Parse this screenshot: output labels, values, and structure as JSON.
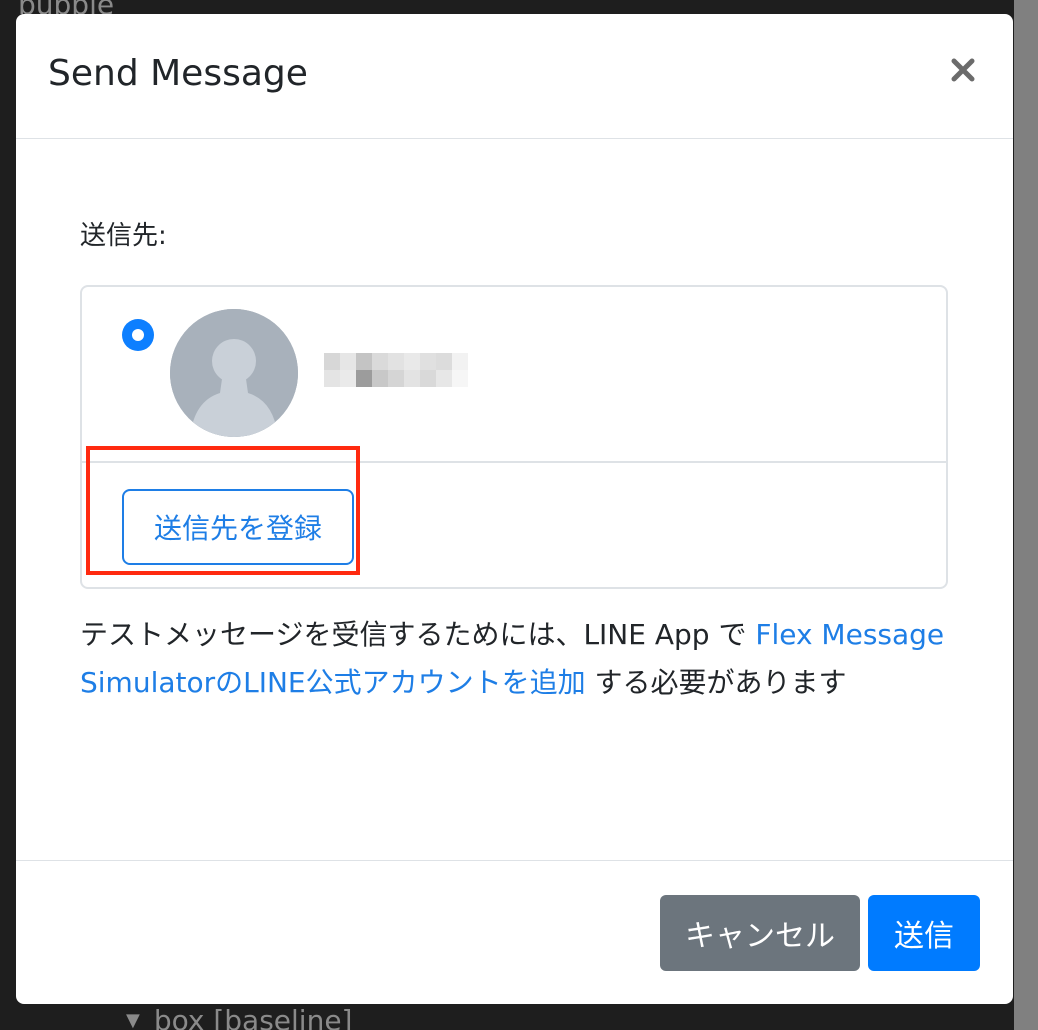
{
  "background": {
    "top_hint": "bubble",
    "bottom_hint": "box [baseline]"
  },
  "modal": {
    "title": "Send Message",
    "close_icon": "close-icon",
    "recipient_label": "送信先:",
    "recipient": {
      "selected": true,
      "avatar_icon": "person-silhouette-icon",
      "name_blurred": true
    },
    "register_button_label": "送信先を登録",
    "info": {
      "prefix": "テストメッセージを受信するためには、LINE App で ",
      "link": "Flex Message SimulatorのLINE公式アカウントを追加",
      "suffix": " する必要があります"
    },
    "footer": {
      "cancel_label": "キャンセル",
      "send_label": "送信"
    }
  },
  "colors": {
    "primary": "#007bff",
    "link": "#1e7ee6",
    "secondary": "#6c757d",
    "highlight": "#ff2a10"
  }
}
